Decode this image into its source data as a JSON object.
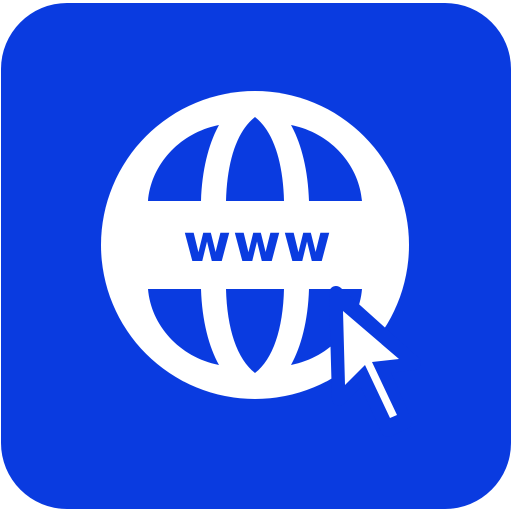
{
  "icon": {
    "name": "web-browser-app-icon",
    "label": "www",
    "background_color": "#0a3be0",
    "foreground_color": "#ffffff",
    "symbols": [
      "globe-icon",
      "cursor-arrow-icon"
    ]
  }
}
